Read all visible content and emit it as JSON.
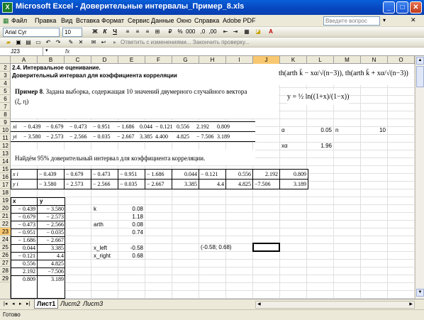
{
  "window": {
    "title": "Microsoft Excel - Доверительные интервалы_Пример_8.xls",
    "icon": "excel-icon"
  },
  "menu": [
    "Файл",
    "Правка",
    "Вид",
    "Вставка",
    "Формат",
    "Сервис",
    "Данные",
    "Окно",
    "Справка",
    "Adobe PDF"
  ],
  "help_placeholder": "Введите вопрос",
  "toolbar": {
    "font": "Arial Cyr",
    "size": "10",
    "bold": "Ж",
    "italic": "К",
    "underline": "Ч",
    "review_text": "Ответить с изменениями...  Закончить проверку..."
  },
  "formula_bar": {
    "cell_ref": "J23",
    "fx": "fx",
    "content": ""
  },
  "columns": [
    "A",
    "B",
    "C",
    "D",
    "E",
    "F",
    "G",
    "H",
    "I",
    "J",
    "K",
    "L",
    "M",
    "N",
    "O"
  ],
  "rows": [
    "2",
    "3",
    "4",
    "5",
    "6",
    "7",
    "8",
    "9",
    "10",
    "11",
    "12",
    "13",
    "14",
    "15",
    "16",
    "17",
    "18",
    "19",
    "20",
    "21",
    "22",
    "23",
    "24",
    "25",
    "26",
    "27",
    "28",
    "29"
  ],
  "selected_cell": "J23",
  "sheet": {
    "heading": "2.4. Интервальное оценивание.",
    "subheading": "Доверительный интервал для коэффициента корреляции",
    "example_label": "Пример 8",
    "example_text": ". Задана выборка, содержащая 10 значений двумерного случайного вектора",
    "vector": "(ξ, η)",
    "formula_top": "th(arth k̄ − xα/√(n−3)), th(arth k̄ + xα/√(n−3))",
    "formula_y": "y = ½ ln((1+x)/(1−x))",
    "row9_label": "xi",
    "row10_label": "yi",
    "x_values": [
      "− 0.439",
      "− 0.679",
      "− 0.473",
      "− 0.951",
      "− 1.686",
      "0.044",
      "− 0.121",
      "0.556",
      "2.192",
      "0.809"
    ],
    "y_values": [
      "− 3.580",
      "− 2.573",
      "− 2.566",
      "− 0.035",
      "− 2.667",
      "3.385",
      "4.400",
      "4.825",
      "− 7.506",
      "3.189"
    ],
    "alpha_label": "α",
    "alpha_value": "0.05",
    "n_label": "n",
    "n_value": "10",
    "xalpha_label": "xα",
    "xalpha_value": "1.96",
    "task": "Найдём 95% доверительный интервал для коэффициента корреляции.",
    "row15_label": "x i",
    "row16_label": "y i",
    "x_table": [
      "− 0.439",
      "− 0.679",
      "− 0.473",
      "− 0.951",
      "− 1.686",
      "0.044",
      "− 0.121",
      "0.556",
      "2.192",
      "0.809"
    ],
    "y_table": [
      "− 3.580",
      "− 2.573",
      "− 2.566",
      "− 0.035",
      "− 2.667",
      "3.385",
      "4.4",
      "4.825",
      "−7.506",
      "3.189"
    ],
    "col_x": "x",
    "col_y": "y",
    "pairs": [
      [
        "− 0.439",
        "− 3.580"
      ],
      [
        "− 0.679",
        "− 2.573"
      ],
      [
        "− 0.473",
        "− 2.566"
      ],
      [
        "− 0.951",
        "− 0.035"
      ],
      [
        "− 1.686",
        "− 2.667"
      ],
      [
        "0.044",
        "3.385"
      ],
      [
        "− 0.121",
        "4.4"
      ],
      [
        "0.556",
        "4.825"
      ],
      [
        "2.192",
        "−7.506"
      ],
      [
        "0.809",
        "3.189"
      ]
    ],
    "calc": [
      [
        "k",
        "0.08"
      ],
      [
        "",
        "1.18"
      ],
      [
        "arth",
        "0.08"
      ],
      [
        "",
        "0.74"
      ],
      [
        "x_left",
        "-0.58"
      ],
      [
        "x_right",
        "0.68"
      ]
    ],
    "interval": "(-0.58; 0.68)"
  },
  "tabs": [
    "Лист1",
    "Лист2",
    "Лист3"
  ],
  "status": "Готово"
}
